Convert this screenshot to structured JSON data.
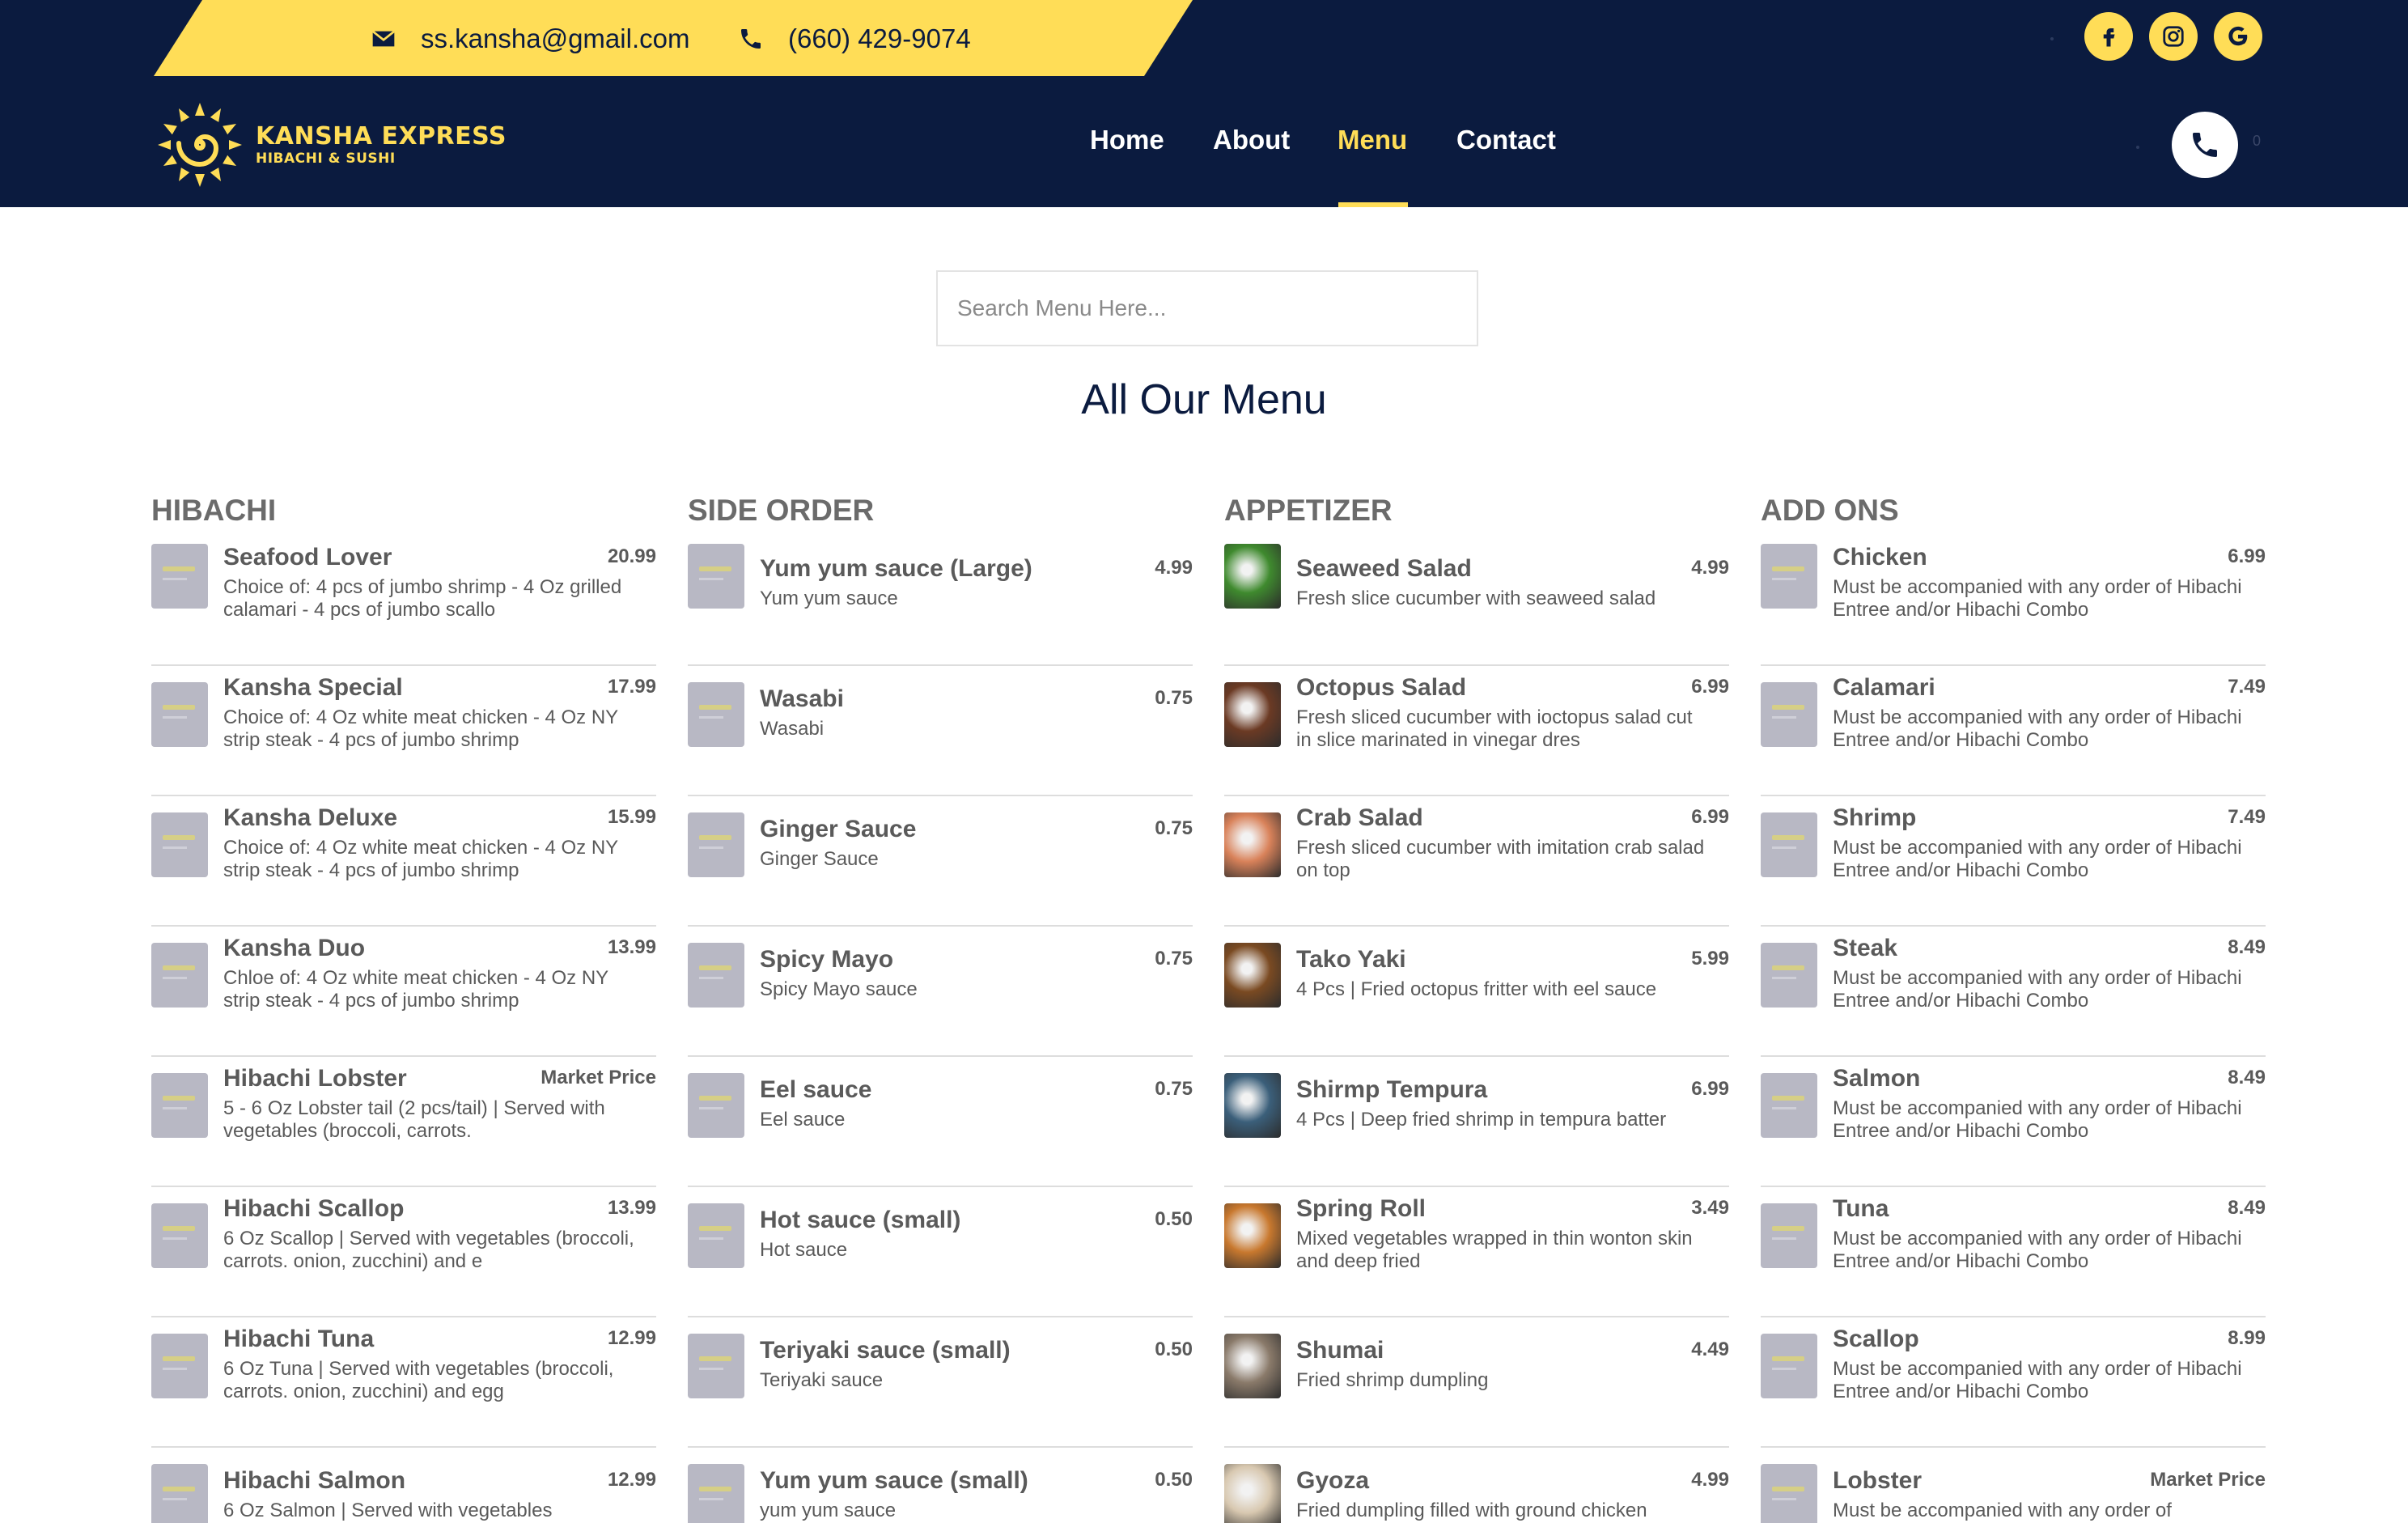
{
  "topbar": {
    "email": "ss.kansha@gmail.com",
    "phone": "(660) 429-9074",
    "social": [
      "facebook-icon",
      "instagram-icon",
      "google-icon"
    ]
  },
  "logo": {
    "title": "KANSHA EXPRESS",
    "subtitle": "HIBACHI & SUSHI"
  },
  "nav": {
    "items": [
      "Home",
      "About",
      "Menu",
      "Contact"
    ],
    "active": "Menu"
  },
  "cart": {
    "count": "0"
  },
  "search": {
    "placeholder": "Search Menu Here..."
  },
  "page_title": "All Our Menu",
  "colors": {
    "navy": "#0b1b3f",
    "yellow": "#ffdd57",
    "text": "#5a5a5a"
  },
  "columns": [
    {
      "title": "HIBACHI",
      "items": [
        {
          "name": "Seafood Lover",
          "price": "20.99",
          "desc": "Choice of: 4 pcs of jumbo shrimp - 4 Oz grilled calamari - 4 pcs of jumbo scallo"
        },
        {
          "name": "Kansha Special",
          "price": "17.99",
          "desc": "Choice of: 4 Oz white meat chicken - 4 Oz NY strip steak - 4 pcs of jumbo shrimp"
        },
        {
          "name": "Kansha Deluxe",
          "price": "15.99",
          "desc": "Choice of: 4 Oz white meat chicken - 4 Oz NY strip steak - 4 pcs of jumbo shrimp"
        },
        {
          "name": "Kansha Duo",
          "price": "13.99",
          "desc": "Chloe of: 4 Oz white meat chicken - 4 Oz NY strip steak - 4 pcs of jumbo shrimp"
        },
        {
          "name": "Hibachi Lobster",
          "price": "Market Price",
          "desc": "5 - 6 Oz Lobster tail (2 pcs/tail) | Served with vegetables (broccoli, carrots."
        },
        {
          "name": "Hibachi Scallop",
          "price": "13.99",
          "desc": "6 Oz Scallop | Served with vegetables (broccoli, carrots. onion, zucchini) and e"
        },
        {
          "name": "Hibachi Tuna",
          "price": "12.99",
          "desc": "6 Oz Tuna | Served with vegetables (broccoli, carrots. onion, zucchini) and egg"
        },
        {
          "name": "Hibachi Salmon",
          "price": "12.99",
          "desc": "6 Oz Salmon | Served with vegetables"
        }
      ]
    },
    {
      "title": "SIDE ORDER",
      "items": [
        {
          "name": "Yum yum sauce (Large)",
          "price": "4.99",
          "desc": "Yum yum sauce"
        },
        {
          "name": "Wasabi",
          "price": "0.75",
          "desc": "Wasabi"
        },
        {
          "name": "Ginger Sauce",
          "price": "0.75",
          "desc": "Ginger Sauce"
        },
        {
          "name": "Spicy Mayo",
          "price": "0.75",
          "desc": "Spicy Mayo sauce"
        },
        {
          "name": "Eel sauce",
          "price": "0.75",
          "desc": "Eel sauce"
        },
        {
          "name": "Hot sauce (small)",
          "price": "0.50",
          "desc": "Hot sauce"
        },
        {
          "name": "Teriyaki sauce (small)",
          "price": "0.50",
          "desc": "Teriyaki sauce"
        },
        {
          "name": "Yum yum sauce (small)",
          "price": "0.50",
          "desc": "yum yum sauce"
        }
      ]
    },
    {
      "title": "APPETIZER",
      "items": [
        {
          "name": "Seaweed Salad",
          "price": "4.99",
          "desc": "Fresh slice cucumber with seaweed salad",
          "photo": "#3f8a2e"
        },
        {
          "name": "Octopus Salad",
          "price": "6.99",
          "desc": "Fresh sliced cucumber with ioctopus salad cut in slice marinated in vinegar dres",
          "photo": "#6b3a24"
        },
        {
          "name": "Crab Salad",
          "price": "6.99",
          "desc": "Fresh sliced cucumber with imitation crab salad on top",
          "photo": "#d9825a"
        },
        {
          "name": "Tako Yaki",
          "price": "5.99",
          "desc": "4 Pcs | Fried octopus fritter with eel sauce",
          "photo": "#7a4a22"
        },
        {
          "name": "Shirmp Tempura",
          "price": "6.99",
          "desc": "4 Pcs | Deep fried shrimp in tempura batter",
          "photo": "#3b5f7a"
        },
        {
          "name": "Spring Roll",
          "price": "3.49",
          "desc": "Mixed vegetables wrapped in thin wonton skin and deep fried",
          "photo": "#c8782e"
        },
        {
          "name": "Shumai",
          "price": "4.49",
          "desc": "Fried shrimp dumpling",
          "photo": "#8a7a6a"
        },
        {
          "name": "Gyoza",
          "price": "4.99",
          "desc": "Fried dumpling filled with ground chicken",
          "photo": "#d8c8b0"
        }
      ]
    },
    {
      "title": "ADD ONS",
      "items": [
        {
          "name": "Chicken",
          "price": "6.99",
          "desc": "Must be accompanied with any order of Hibachi Entree and/or Hibachi Combo"
        },
        {
          "name": "Calamari",
          "price": "7.49",
          "desc": "Must be accompanied with any order of Hibachi Entree and/or Hibachi Combo"
        },
        {
          "name": "Shrimp",
          "price": "7.49",
          "desc": "Must be accompanied with any order of Hibachi Entree and/or Hibachi Combo"
        },
        {
          "name": "Steak",
          "price": "8.49",
          "desc": "Must be accompanied with any order of Hibachi Entree and/or Hibachi Combo"
        },
        {
          "name": "Salmon",
          "price": "8.49",
          "desc": "Must be accompanied with any order of Hibachi Entree and/or Hibachi Combo"
        },
        {
          "name": "Tuna",
          "price": "8.49",
          "desc": "Must be accompanied with any order of Hibachi Entree and/or Hibachi Combo"
        },
        {
          "name": "Scallop",
          "price": "8.99",
          "desc": "Must be accompanied with any order of Hibachi Entree and/or Hibachi Combo"
        },
        {
          "name": "Lobster",
          "price": "Market Price",
          "desc": "Must be accompanied with any order of"
        }
      ]
    }
  ]
}
